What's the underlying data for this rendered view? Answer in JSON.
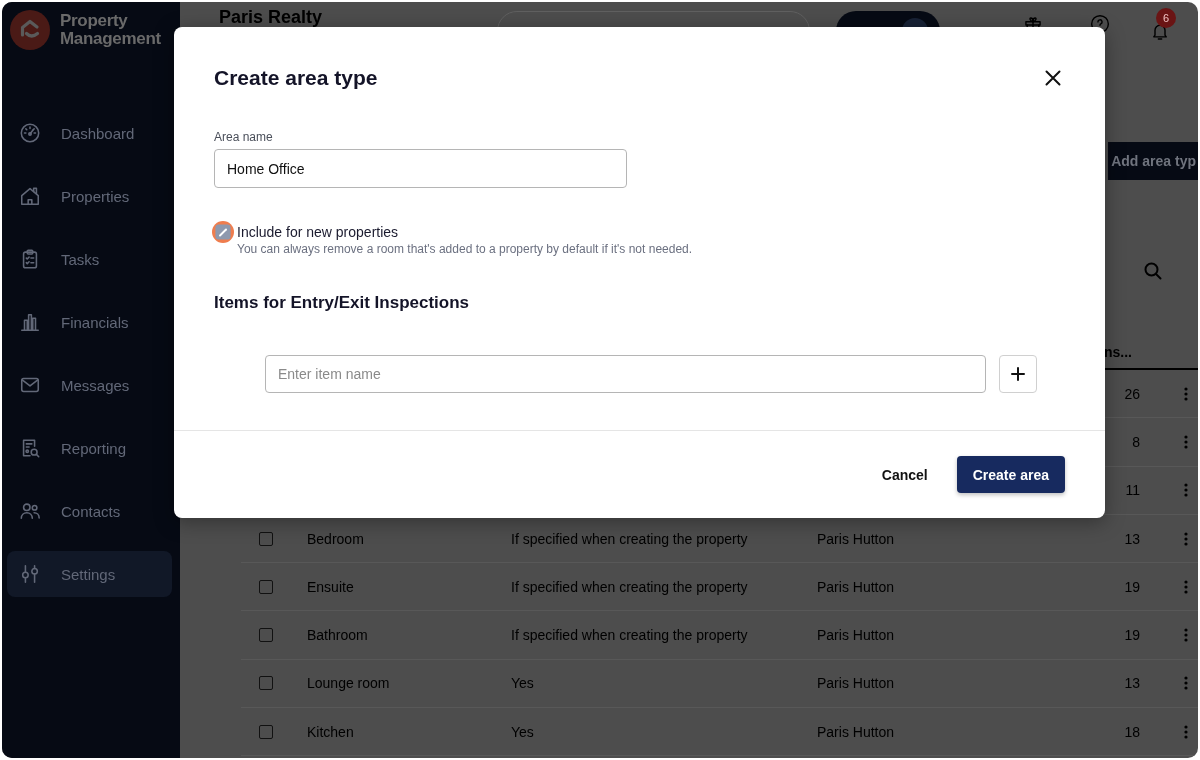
{
  "sidebar": {
    "brand": "Property Management",
    "items": [
      {
        "label": "Dashboard",
        "selected": false
      },
      {
        "label": "Properties",
        "selected": false
      },
      {
        "label": "Tasks",
        "selected": false
      },
      {
        "label": "Financials",
        "selected": false
      },
      {
        "label": "Messages",
        "selected": false
      },
      {
        "label": "Reporting",
        "selected": false
      },
      {
        "label": "Contacts",
        "selected": false
      },
      {
        "label": "Settings",
        "selected": true
      }
    ]
  },
  "header": {
    "title": "Paris Realty",
    "notification_count": "6"
  },
  "toolbar": {
    "add_button": "Add area typ"
  },
  "table": {
    "columns": {
      "column_4": "ns..."
    },
    "rows": [
      {
        "column_4": "26"
      },
      {
        "column_4": "8"
      },
      {
        "column_4": "11"
      },
      {
        "selected": false,
        "column_1": "Bedroom",
        "column_2": "If specified when creating the property",
        "column_3": "Paris Hutton",
        "column_4": "13"
      },
      {
        "selected": false,
        "column_1": "Ensuite",
        "column_2": "If specified when creating the property",
        "column_3": "Paris Hutton",
        "column_4": "19"
      },
      {
        "selected": false,
        "column_1": "Bathroom",
        "column_2": "If specified when creating the property",
        "column_3": "Paris Hutton",
        "column_4": "19"
      },
      {
        "selected": false,
        "column_1": "Lounge room",
        "column_2": "Yes",
        "column_3": "Paris Hutton",
        "column_4": "13"
      },
      {
        "selected": false,
        "column_1": "Kitchen",
        "column_2": "Yes",
        "column_3": "Paris Hutton",
        "column_4": "18"
      }
    ]
  },
  "modal": {
    "title": "Create area type",
    "area_name": {
      "label": "Area name",
      "value": "Home Office"
    },
    "include_new": {
      "label": "Include for new properties",
      "hint": "You can always remove a room that's added to a property by default if it's not needed.",
      "checked": true,
      "focused": true
    },
    "items_heading": "Items for Entry/Exit Inspections",
    "item_input": {
      "placeholder": "Enter item name"
    },
    "cancel_button": "Cancel",
    "submit_button": "Create area"
  }
}
